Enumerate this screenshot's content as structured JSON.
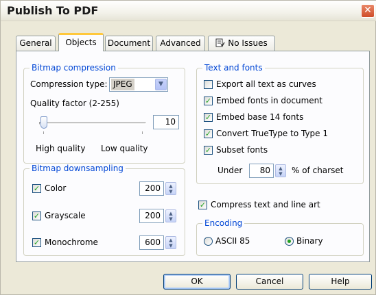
{
  "window": {
    "title": "Publish To PDF",
    "close_glyph": "✕"
  },
  "tabs": [
    {
      "label": "General"
    },
    {
      "label": "Objects"
    },
    {
      "label": "Document"
    },
    {
      "label": "Advanced"
    },
    {
      "label": "No Issues",
      "icon": "issues-icon"
    }
  ],
  "active_tab": "Objects",
  "bitmap_compression": {
    "title": "Bitmap compression",
    "compression_type_label": "Compression type:",
    "compression_type_value": "JPEG",
    "quality_label": "Quality factor (2-255)",
    "quality_value": "10",
    "quality_slider_fraction": 0.04,
    "high_label": "High quality",
    "low_label": "Low quality"
  },
  "bitmap_downsampling": {
    "title": "Bitmap downsampling",
    "rows": [
      {
        "label": "Color",
        "checked": true,
        "value": "200"
      },
      {
        "label": "Grayscale",
        "checked": true,
        "value": "200"
      },
      {
        "label": "Monochrome",
        "checked": true,
        "value": "600"
      }
    ]
  },
  "text_fonts": {
    "title": "Text and fonts",
    "options": [
      {
        "label": "Export all text as curves",
        "checked": false
      },
      {
        "label": "Embed fonts in document",
        "checked": true
      },
      {
        "label": "Embed base 14 fonts",
        "checked": true
      },
      {
        "label": "Convert TrueType to Type 1",
        "checked": true
      },
      {
        "label": "Subset fonts",
        "checked": true
      }
    ],
    "under_label": "Under",
    "under_value": "80",
    "charset_label": "% of charset"
  },
  "compress": {
    "label": "Compress text and line art",
    "checked": true
  },
  "encoding": {
    "title": "Encoding",
    "options": [
      {
        "label": "ASCII 85",
        "selected": false
      },
      {
        "label": "Binary",
        "selected": true
      }
    ]
  },
  "buttons": {
    "ok": "OK",
    "cancel": "Cancel",
    "help": "Help"
  },
  "colors": {
    "group_title": "#0046d5",
    "check": "#21a121",
    "tab_highlight": "#ffc83c"
  }
}
